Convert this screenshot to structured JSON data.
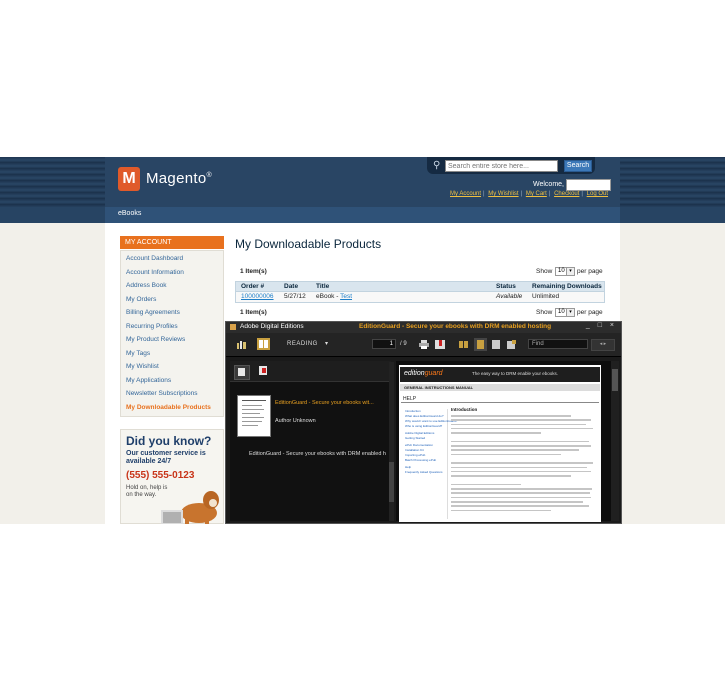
{
  "header": {
    "logo_text": "Magento",
    "logo_mark": "®",
    "search_placeholder": "Search entire store here...",
    "search_button": "Search",
    "welcome_label": "Welcome,",
    "top_links": [
      "My Account",
      "My Wishlist",
      "My Cart",
      "Checkout",
      "Log Out"
    ]
  },
  "breadcrumb": {
    "current": "eBooks"
  },
  "sidebar": {
    "title": "MY ACCOUNT",
    "items": [
      {
        "label": "Account Dashboard",
        "active": false
      },
      {
        "label": "Account Information",
        "active": false
      },
      {
        "label": "Address Book",
        "active": false
      },
      {
        "label": "My Orders",
        "active": false
      },
      {
        "label": "Billing Agreements",
        "active": false
      },
      {
        "label": "Recurring Profiles",
        "active": false
      },
      {
        "label": "My Product Reviews",
        "active": false
      },
      {
        "label": "My Tags",
        "active": false
      },
      {
        "label": "My Wishlist",
        "active": false
      },
      {
        "label": "My Applications",
        "active": false
      },
      {
        "label": "Newsletter Subscriptions",
        "active": false
      },
      {
        "label": "My Downloadable Products",
        "active": true
      }
    ]
  },
  "promo": {
    "heading": "Did you know?",
    "line1": "Our customer service is",
    "line2": "available 24/7",
    "phone": "(555) 555-0123",
    "line3": "Hold on, help is",
    "line4": "on the way."
  },
  "main": {
    "title": "My Downloadable Products",
    "items_count": "1 Item(s)",
    "show_label": "Show",
    "per_page_value": "10",
    "per_page_label": "per page",
    "columns": [
      "Order #",
      "Date",
      "Title",
      "Status",
      "Remaining Downloads"
    ],
    "rows": [
      {
        "order": "100000006",
        "date": "5/27/12",
        "title_prefix": "eBook - ",
        "title_link": "Test",
        "status": "Available",
        "remaining": "Unlimited"
      }
    ]
  },
  "ade": {
    "app_title": "Adobe Digital Editions",
    "doc_title": "EditionGuard - Secure your ebooks with DRM enabled hosting",
    "window_controls": "_ □ ×",
    "view_mode": "READING",
    "page_current": "1",
    "page_total": "/ 9",
    "find_placeholder": "Find",
    "prev_next": "◂ ▸",
    "library": {
      "book_title": "EditionGuard - Secure your ebooks wit...",
      "book_author": "Author Unknown",
      "book_title_full": "EditionGuard - Secure your ebooks with DRM enabled h"
    },
    "page": {
      "logo_a": "edition",
      "logo_b": "guard",
      "tagline": "The easy way to DRM enable your ebooks.",
      "manual": "GENERAL INSTRUCTIONS MANUAL",
      "help": "HELP",
      "intro": "Introduction",
      "nav": [
        "Introduction",
        "What does EditionGuard do?",
        "Why would I want to use EditionGuard?",
        "Who is using EditionGuard?",
        "Adobe Digital Editions",
        "Getting Started",
        "ePub Documentation",
        "Installation Kit",
        "Importing ePub",
        "Batch Processing ePub",
        "Help",
        "Frequently Asked Questions"
      ]
    }
  },
  "colors": {
    "header_bg": "#1e3550",
    "accent_orange": "#e8711e",
    "link_blue": "#336699",
    "ade_bg": "#1a1a1a",
    "ade_accent": "#e8a020"
  }
}
